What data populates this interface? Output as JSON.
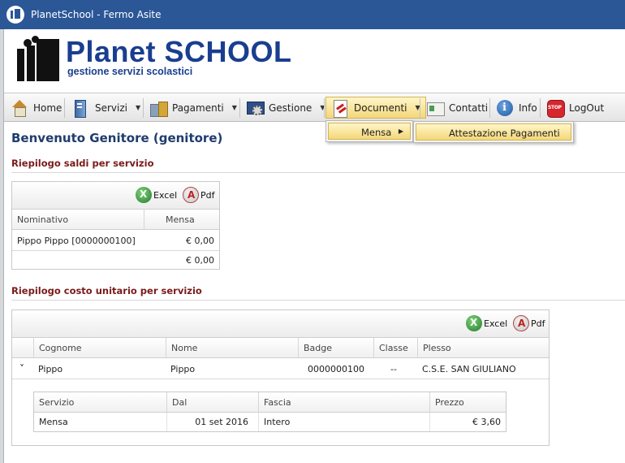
{
  "window": {
    "title": "PlanetSchool - Fermo Asite"
  },
  "logo": {
    "title": "Planet SCHOOL",
    "subtitle": "gestione servizi scolastici"
  },
  "menu": {
    "home": "Home",
    "servizi": "Servizi",
    "pagamenti": "Pagamenti",
    "gestione": "Gestione",
    "documenti": "Documenti",
    "contatti": "Contatti",
    "info": "Info",
    "logout": "LogOut"
  },
  "submenu": {
    "level1": "Mensa",
    "level2": "Attestazione Pagamenti"
  },
  "welcome": "Benvenuto Genitore (genitore)",
  "saldi": {
    "title": "Riepilogo saldi per servizio",
    "excel": "Excel",
    "pdf": "Pdf",
    "headers": [
      "Nominativo",
      "Mensa"
    ],
    "rows": [
      [
        "Pippo Pippo [0000000100]",
        "€ 0,00"
      ]
    ],
    "total": "€ 0,00"
  },
  "costo": {
    "title": "Riepilogo costo unitario per servizio",
    "excel": "Excel",
    "pdf": "Pdf",
    "headers": [
      "Cognome",
      "Nome",
      "Badge",
      "Classe",
      "Plesso"
    ],
    "rows": [
      [
        "Pippo",
        "Pippo",
        "0000000100",
        "--",
        "C.S.E. SAN GIULIANO"
      ]
    ],
    "expand_glyph": "˅",
    "detail_headers": [
      "Servizio",
      "Dal",
      "Fascia",
      "Prezzo"
    ],
    "detail_rows": [
      [
        "Mensa",
        "01 set 2016",
        "Intero",
        "€ 3,60"
      ]
    ]
  }
}
